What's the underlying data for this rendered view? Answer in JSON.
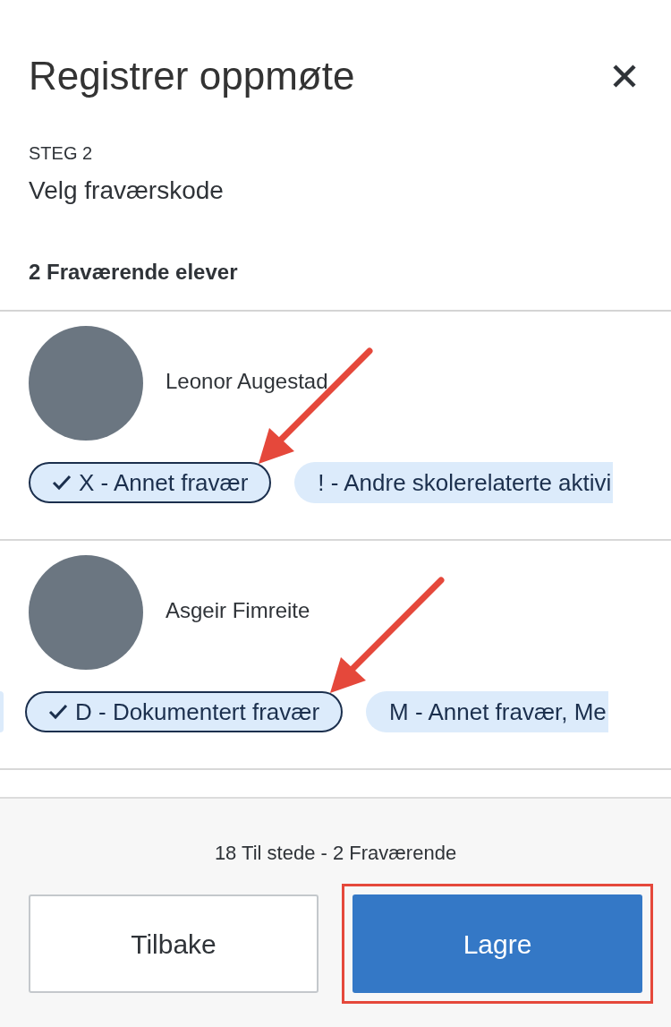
{
  "title": "Registrer oppmøte",
  "step": {
    "label": "STEG 2",
    "heading": "Velg fraværskode"
  },
  "section_title": "2 Fraværende elever",
  "students": [
    {
      "name": "Leonor Augestad",
      "scrolled": false,
      "codes": [
        {
          "label": "X - Annet fravær",
          "selected": true,
          "arrow": true
        },
        {
          "label": "! - Andre skolerelaterte aktivi",
          "selected": false,
          "arrow": false
        }
      ]
    },
    {
      "name": "Asgeir Fimreite",
      "scrolled": true,
      "codes": [
        {
          "label": "D - Dokumentert fravær",
          "selected": true,
          "arrow": true
        },
        {
          "label": "M - Annet fravær, Me",
          "selected": false,
          "arrow": false
        }
      ]
    }
  ],
  "summary": "18 Til stede - 2 Fraværende",
  "buttons": [
    {
      "label": "Tilbake",
      "kind": "secondary",
      "highlighted": false
    },
    {
      "label": "Lagre",
      "kind": "primary",
      "highlighted": true
    }
  ]
}
